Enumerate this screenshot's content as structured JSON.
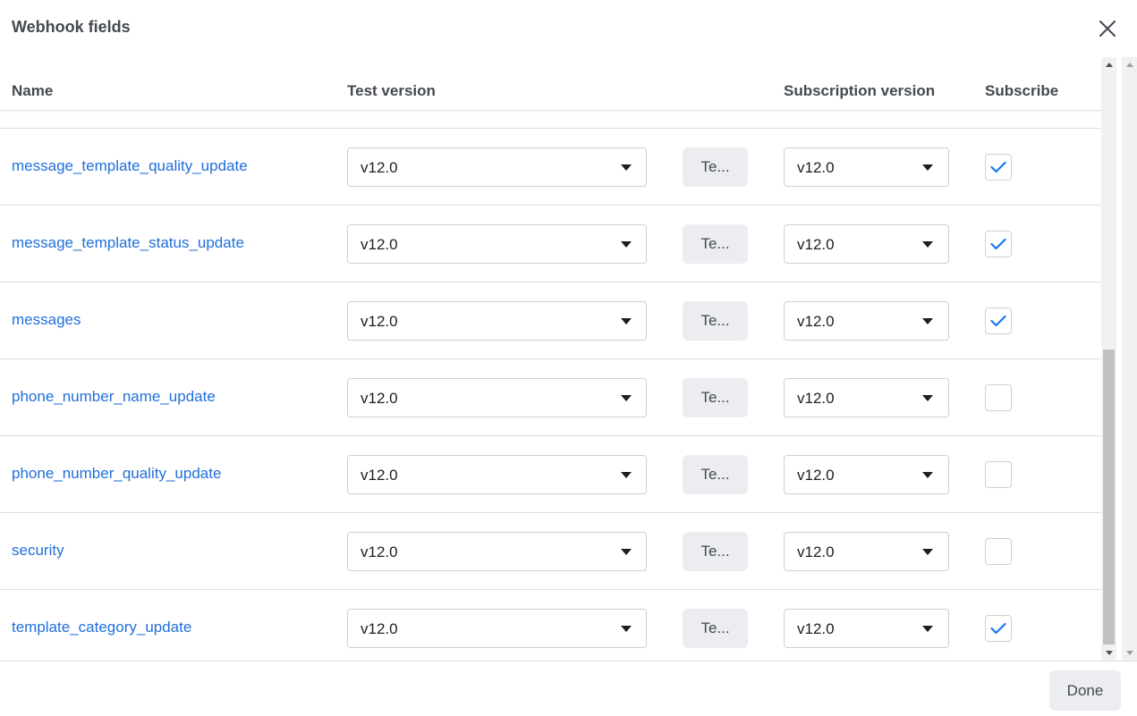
{
  "dialog": {
    "title": "Webhook fields",
    "close_icon": "close-icon",
    "done_label": "Done"
  },
  "table": {
    "headers": {
      "name": "Name",
      "test_version": "Test version",
      "subscription_version": "Subscription version",
      "subscribe": "Subscribe"
    },
    "rows": [
      {
        "field": "message_template_quality_update",
        "test_version": "v12.0",
        "test_label": "Te...",
        "subscription_version": "v12.0",
        "subscribed": true
      },
      {
        "field": "message_template_status_update",
        "test_version": "v12.0",
        "test_label": "Te...",
        "subscription_version": "v12.0",
        "subscribed": true
      },
      {
        "field": "messages",
        "test_version": "v12.0",
        "test_label": "Te...",
        "subscription_version": "v12.0",
        "subscribed": true
      },
      {
        "field": "phone_number_name_update",
        "test_version": "v12.0",
        "test_label": "Te...",
        "subscription_version": "v12.0",
        "subscribed": false
      },
      {
        "field": "phone_number_quality_update",
        "test_version": "v12.0",
        "test_label": "Te...",
        "subscription_version": "v12.0",
        "subscribed": false
      },
      {
        "field": "security",
        "test_version": "v12.0",
        "test_label": "Te...",
        "subscription_version": "v12.0",
        "subscribed": false
      },
      {
        "field": "template_category_update",
        "test_version": "v12.0",
        "test_label": "Te...",
        "subscription_version": "v12.0",
        "subscribed": true
      }
    ]
  },
  "colors": {
    "link": "#216fdb",
    "check": "#1877f2",
    "button_bg": "#ebedf0"
  },
  "icons": {
    "dropdown": "caret-down-icon",
    "checked": "checkmark-icon",
    "scroll_up": "scroll-up-arrow-icon",
    "scroll_down": "scroll-down-arrow-icon"
  }
}
